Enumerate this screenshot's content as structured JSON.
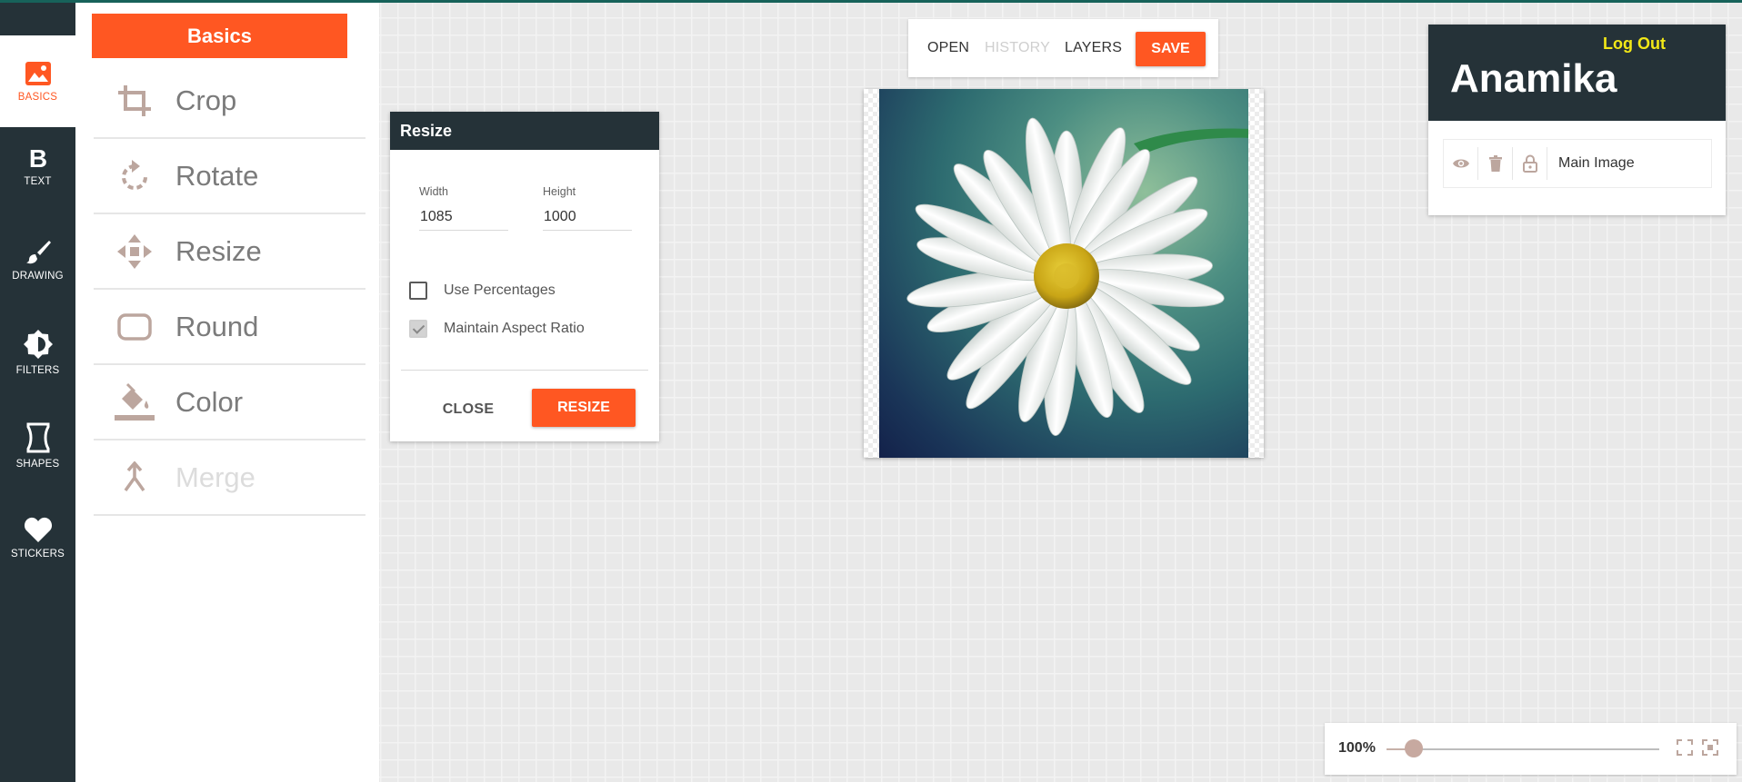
{
  "colors": {
    "accent": "#ff5722",
    "dark": "#253238",
    "username": "#ffffff",
    "logout": "#f2e817"
  },
  "nav": [
    {
      "label": "BASICS",
      "icon": "image-icon",
      "active": true
    },
    {
      "label": "TEXT",
      "icon": "bold-text-icon"
    },
    {
      "label": "DRAWING",
      "icon": "brush-icon"
    },
    {
      "label": "FILTERS",
      "icon": "brightness-icon"
    },
    {
      "label": "SHAPES",
      "icon": "shape-icon"
    },
    {
      "label": "STICKERS",
      "icon": "heart-icon"
    }
  ],
  "panel": {
    "title": "Basics",
    "tools": [
      {
        "label": "Crop",
        "icon": "crop-icon"
      },
      {
        "label": "Rotate",
        "icon": "rotate-icon"
      },
      {
        "label": "Resize",
        "icon": "resize-arrows-icon"
      },
      {
        "label": "Round",
        "icon": "round-corner-icon"
      },
      {
        "label": "Color",
        "icon": "paint-bucket-icon"
      },
      {
        "label": "Merge",
        "icon": "merge-icon",
        "disabled": true
      }
    ]
  },
  "dialog": {
    "title": "Resize",
    "width_label": "Width",
    "width_value": "1085",
    "height_label": "Height",
    "height_value": "1000",
    "use_percentages": "Use Percentages",
    "use_percentages_checked": false,
    "maintain_aspect": "Maintain Aspect Ratio",
    "maintain_aspect_checked": true,
    "close_label": "CLOSE",
    "resize_label": "RESIZE"
  },
  "toolbar": {
    "open": "OPEN",
    "history": "HISTORY",
    "layers": "LAYERS",
    "save": "SAVE"
  },
  "user": {
    "name": "Anamika",
    "logout": "Log Out"
  },
  "layers": [
    {
      "name": "Main Image"
    }
  ],
  "zoom": {
    "label": "100%",
    "level": 0.1
  }
}
